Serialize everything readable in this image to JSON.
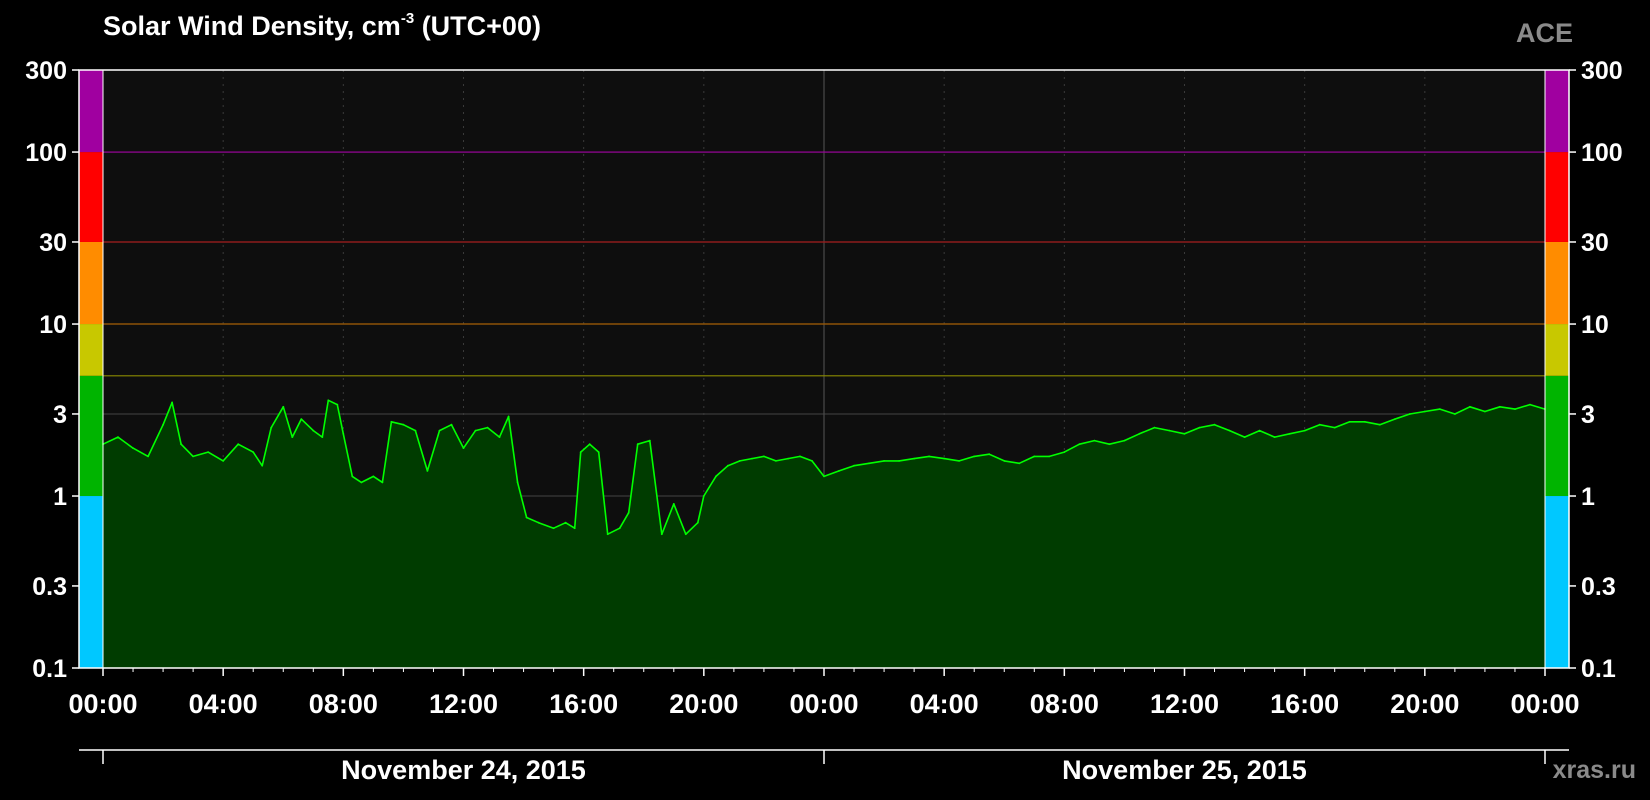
{
  "chart_data": {
    "type": "area",
    "title": "Solar Wind Density, cm",
    "title_exponent": "-3",
    "title_suffix": "(UTC+00)",
    "source": "ACE",
    "credit": "xras.ru",
    "y_scale": "log",
    "ylim": [
      0.1,
      300
    ],
    "y_ticks": [
      0.1,
      0.3,
      1,
      3,
      10,
      30,
      100,
      300
    ],
    "y_tick_labels": [
      "0.1",
      "0.3",
      "1",
      "3",
      "10",
      "30",
      "100",
      "300"
    ],
    "x_range_hours": [
      0,
      48
    ],
    "x_ticks_hours": [
      0,
      4,
      8,
      12,
      16,
      20,
      24,
      28,
      32,
      36,
      40,
      44,
      48
    ],
    "x_tick_labels": [
      "00:00",
      "04:00",
      "08:00",
      "12:00",
      "16:00",
      "20:00",
      "00:00",
      "04:00",
      "08:00",
      "12:00",
      "16:00",
      "20:00",
      "00:00"
    ],
    "dates": [
      "November 24, 2015",
      "November 25, 2015"
    ],
    "levels": [
      {
        "from": 0.1,
        "to": 1,
        "color": "#00c8ff"
      },
      {
        "from": 1,
        "to": 5,
        "color": "#00b400"
      },
      {
        "from": 5,
        "to": 10,
        "color": "#c8c800"
      },
      {
        "from": 10,
        "to": 30,
        "color": "#ff8c00"
      },
      {
        "from": 30,
        "to": 100,
        "color": "#ff0000"
      },
      {
        "from": 100,
        "to": 300,
        "color": "#a000a0"
      }
    ],
    "threshold_lines": [
      {
        "value": 5,
        "color": "#8a8a00"
      },
      {
        "value": 10,
        "color": "#a05a00"
      },
      {
        "value": 30,
        "color": "#a01818"
      },
      {
        "value": 100,
        "color": "#a000a0"
      }
    ],
    "grid": true,
    "series": [
      {
        "color": "#00ff00",
        "fill": "#003c00",
        "points": [
          [
            0.0,
            2.0
          ],
          [
            0.5,
            2.2
          ],
          [
            1.0,
            1.9
          ],
          [
            1.5,
            1.7
          ],
          [
            2.0,
            2.6
          ],
          [
            2.3,
            3.5
          ],
          [
            2.6,
            2.0
          ],
          [
            3.0,
            1.7
          ],
          [
            3.5,
            1.8
          ],
          [
            4.0,
            1.6
          ],
          [
            4.5,
            2.0
          ],
          [
            5.0,
            1.8
          ],
          [
            5.3,
            1.5
          ],
          [
            5.6,
            2.5
          ],
          [
            6.0,
            3.3
          ],
          [
            6.3,
            2.2
          ],
          [
            6.6,
            2.8
          ],
          [
            7.0,
            2.4
          ],
          [
            7.3,
            2.2
          ],
          [
            7.5,
            3.6
          ],
          [
            7.8,
            3.4
          ],
          [
            8.0,
            2.3
          ],
          [
            8.3,
            1.3
          ],
          [
            8.6,
            1.2
          ],
          [
            9.0,
            1.3
          ],
          [
            9.3,
            1.2
          ],
          [
            9.6,
            2.7
          ],
          [
            10.0,
            2.6
          ],
          [
            10.4,
            2.4
          ],
          [
            10.8,
            1.4
          ],
          [
            11.2,
            2.4
          ],
          [
            11.6,
            2.6
          ],
          [
            12.0,
            1.9
          ],
          [
            12.4,
            2.4
          ],
          [
            12.8,
            2.5
          ],
          [
            13.2,
            2.2
          ],
          [
            13.5,
            2.9
          ],
          [
            13.8,
            1.2
          ],
          [
            14.1,
            0.75
          ],
          [
            14.5,
            0.7
          ],
          [
            15.0,
            0.65
          ],
          [
            15.4,
            0.7
          ],
          [
            15.7,
            0.65
          ],
          [
            15.9,
            1.8
          ],
          [
            16.2,
            2.0
          ],
          [
            16.5,
            1.8
          ],
          [
            16.8,
            0.6
          ],
          [
            17.2,
            0.65
          ],
          [
            17.5,
            0.8
          ],
          [
            17.8,
            2.0
          ],
          [
            18.2,
            2.1
          ],
          [
            18.6,
            0.6
          ],
          [
            19.0,
            0.9
          ],
          [
            19.4,
            0.6
          ],
          [
            19.8,
            0.7
          ],
          [
            20.0,
            1.0
          ],
          [
            20.4,
            1.3
          ],
          [
            20.8,
            1.5
          ],
          [
            21.2,
            1.6
          ],
          [
            21.6,
            1.65
          ],
          [
            22.0,
            1.7
          ],
          [
            22.4,
            1.6
          ],
          [
            22.8,
            1.65
          ],
          [
            23.2,
            1.7
          ],
          [
            23.6,
            1.6
          ],
          [
            24.0,
            1.3
          ],
          [
            24.5,
            1.4
          ],
          [
            25.0,
            1.5
          ],
          [
            25.5,
            1.55
          ],
          [
            26.0,
            1.6
          ],
          [
            26.5,
            1.6
          ],
          [
            27.0,
            1.65
          ],
          [
            27.5,
            1.7
          ],
          [
            28.0,
            1.65
          ],
          [
            28.5,
            1.6
          ],
          [
            29.0,
            1.7
          ],
          [
            29.5,
            1.75
          ],
          [
            30.0,
            1.6
          ],
          [
            30.5,
            1.55
          ],
          [
            31.0,
            1.7
          ],
          [
            31.5,
            1.7
          ],
          [
            32.0,
            1.8
          ],
          [
            32.5,
            2.0
          ],
          [
            33.0,
            2.1
          ],
          [
            33.5,
            2.0
          ],
          [
            34.0,
            2.1
          ],
          [
            34.5,
            2.3
          ],
          [
            35.0,
            2.5
          ],
          [
            35.5,
            2.4
          ],
          [
            36.0,
            2.3
          ],
          [
            36.5,
            2.5
          ],
          [
            37.0,
            2.6
          ],
          [
            37.5,
            2.4
          ],
          [
            38.0,
            2.2
          ],
          [
            38.5,
            2.4
          ],
          [
            39.0,
            2.2
          ],
          [
            39.5,
            2.3
          ],
          [
            40.0,
            2.4
          ],
          [
            40.5,
            2.6
          ],
          [
            41.0,
            2.5
          ],
          [
            41.5,
            2.7
          ],
          [
            42.0,
            2.7
          ],
          [
            42.5,
            2.6
          ],
          [
            43.0,
            2.8
          ],
          [
            43.5,
            3.0
          ],
          [
            44.0,
            3.1
          ],
          [
            44.5,
            3.2
          ],
          [
            45.0,
            3.0
          ],
          [
            45.5,
            3.3
          ],
          [
            46.0,
            3.1
          ],
          [
            46.5,
            3.3
          ],
          [
            47.0,
            3.2
          ],
          [
            47.5,
            3.4
          ],
          [
            48.0,
            3.2
          ]
        ]
      }
    ]
  }
}
